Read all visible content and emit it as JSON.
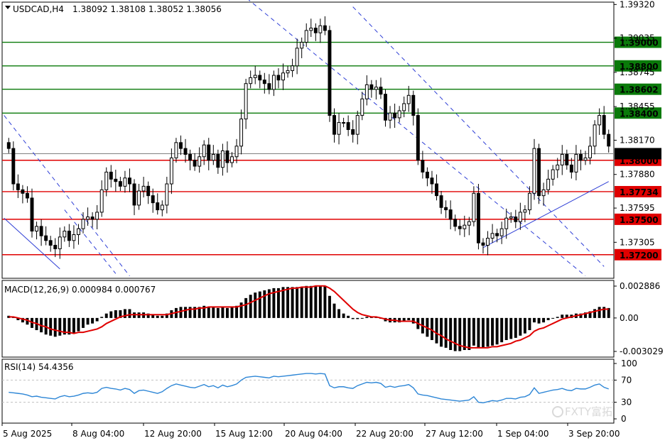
{
  "header": {
    "symbol_tf": "USDCAD,H4",
    "ohlc": "1.38092 1.38108 1.38052 1.38056"
  },
  "watermark": "FXTY富拓",
  "colors": {
    "bull": "#ffffff",
    "bear": "#000000",
    "candle_stroke": "#000000",
    "green_level": "#0a7a0a",
    "red_level": "#e00000",
    "channel": "#2f3fd6",
    "macd_signal": "#e00000",
    "rsi": "#2d86d6"
  },
  "main_chart": {
    "ylim": [
      1.37,
      1.3934
    ],
    "right_axis_ticks": [
      "1.39320",
      "1.39035",
      "1.38745",
      "1.38455",
      "1.38170",
      "1.37880",
      "1.37595",
      "1.37305"
    ],
    "current_price_label": "1.38056",
    "levels": [
      {
        "price": 1.39,
        "label": "1.39000",
        "color": "green"
      },
      {
        "price": 1.388,
        "label": "1.38800",
        "color": "green"
      },
      {
        "price": 1.38602,
        "label": "1.38602",
        "color": "green"
      },
      {
        "price": 1.384,
        "label": "1.38400",
        "color": "green"
      },
      {
        "price": 1.38,
        "label": "1.38000",
        "color": "red"
      },
      {
        "price": 1.37734,
        "label": "1.37734",
        "color": "red"
      },
      {
        "price": 1.375,
        "label": "1.37500",
        "color": "red"
      },
      {
        "price": 1.372,
        "label": "1.37200",
        "color": "red"
      }
    ]
  },
  "chart_data": {
    "type": "candlestick",
    "title": "USDCAD,H4",
    "x_tick_labels": [
      "5 Aug 2025",
      "8 Aug 04:00",
      "12 Aug 20:00",
      "15 Aug 12:00",
      "20 Aug 04:00",
      "22 Aug 20:00",
      "27 Aug 12:00",
      "1 Sep 04:00",
      "3 Sep 20:00"
    ],
    "close": [
      1.381,
      1.378,
      1.3775,
      1.3772,
      1.3768,
      1.374,
      1.3744,
      1.3736,
      1.3732,
      1.3728,
      1.3725,
      1.3735,
      1.374,
      1.3732,
      1.3737,
      1.3742,
      1.375,
      1.3752,
      1.375,
      1.3756,
      1.3775,
      1.379,
      1.3784,
      1.3782,
      1.3778,
      1.3785,
      1.378,
      1.3762,
      1.3774,
      1.3778,
      1.377,
      1.3764,
      1.3758,
      1.3762,
      1.378,
      1.3802,
      1.3815,
      1.381,
      1.3805,
      1.38,
      1.3795,
      1.3803,
      1.3813,
      1.38,
      1.3805,
      1.3794,
      1.3808,
      1.3798,
      1.3803,
      1.3812,
      1.3835,
      1.3865,
      1.387,
      1.3872,
      1.3868,
      1.3865,
      1.386,
      1.3872,
      1.3868,
      1.3874,
      1.3876,
      1.388,
      1.3895,
      1.39,
      1.391,
      1.3912,
      1.3908,
      1.3914,
      1.391,
      1.3838,
      1.3822,
      1.3832,
      1.3832,
      1.3826,
      1.3822,
      1.3838,
      1.3852,
      1.3864,
      1.386,
      1.3862,
      1.3856,
      1.3834,
      1.384,
      1.3836,
      1.3842,
      1.3848,
      1.3855,
      1.3838,
      1.38,
      1.379,
      1.3785,
      1.378,
      1.377,
      1.376,
      1.3758,
      1.375,
      1.3744,
      1.3742,
      1.3745,
      1.3748,
      1.3772,
      1.373,
      1.3728,
      1.3734,
      1.3738,
      1.3736,
      1.3742,
      1.3751,
      1.3752,
      1.3748,
      1.3756,
      1.3758,
      1.3772,
      1.381,
      1.377,
      1.3775,
      1.3784,
      1.3792,
      1.3796,
      1.3805,
      1.3796,
      1.379,
      1.3805,
      1.38,
      1.3802,
      1.3812,
      1.383,
      1.3838,
      1.3822,
      1.3812
    ],
    "series": [
      {
        "name": "MACD(12,26,9)",
        "last_main": 0.000984,
        "last_signal": 0.000767
      },
      {
        "name": "RSI(14)",
        "last": 54.4356
      }
    ],
    "macd_axis_labels": [
      "0.002886",
      "0.00",
      "-0.003029"
    ],
    "rsi_axis_labels": [
      "100",
      "70",
      "30",
      "0"
    ],
    "rsi_values": [
      48,
      47,
      46,
      45,
      43,
      40,
      41,
      39,
      38,
      37,
      36,
      40,
      42,
      40,
      41,
      43,
      46,
      47,
      46,
      48,
      55,
      57,
      55,
      54,
      52,
      55,
      53,
      46,
      51,
      52,
      50,
      48,
      46,
      49,
      55,
      60,
      63,
      61,
      59,
      57,
      56,
      59,
      62,
      58,
      60,
      56,
      61,
      58,
      60,
      63,
      70,
      75,
      76,
      77,
      76,
      75,
      74,
      77,
      76,
      77,
      78,
      79,
      80,
      81,
      82,
      82,
      81,
      82,
      81,
      60,
      56,
      58,
      58,
      56,
      55,
      60,
      63,
      66,
      65,
      66,
      64,
      57,
      59,
      57,
      59,
      60,
      62,
      56,
      45,
      43,
      42,
      40,
      38,
      36,
      35,
      34,
      33,
      32,
      33,
      34,
      40,
      30,
      29,
      31,
      33,
      32,
      34,
      37,
      37,
      36,
      39,
      40,
      44,
      56,
      46,
      48,
      50,
      52,
      53,
      55,
      52,
      51,
      55,
      54,
      54,
      57,
      61,
      63,
      57,
      54
    ],
    "ylim": [
      1.37,
      1.3934
    ]
  },
  "macd_panel": {
    "title": "MACD(12,26,9) 0.000984 0.000767",
    "histogram": [
      0.0002,
      0.0001,
      -0.0002,
      -0.0004,
      -0.0006,
      -0.0009,
      -0.0011,
      -0.0013,
      -0.0015,
      -0.0016,
      -0.0017,
      -0.0016,
      -0.0015,
      -0.0015,
      -0.0014,
      -0.0012,
      -0.0009,
      -0.0006,
      -0.0005,
      -0.0003,
      0.0001,
      0.0004,
      0.0006,
      0.0007,
      0.0007,
      0.0008,
      0.0008,
      0.0005,
      0.0005,
      0.0005,
      0.0004,
      0.0003,
      0.0002,
      0.0002,
      0.0004,
      0.0007,
      0.0009,
      0.001,
      0.001,
      0.001,
      0.001,
      0.001,
      0.0011,
      0.001,
      0.001,
      0.0009,
      0.001,
      0.0009,
      0.001,
      0.0011,
      0.0014,
      0.0018,
      0.0021,
      0.0023,
      0.0024,
      0.0025,
      0.0026,
      0.0027,
      0.0027,
      0.0028,
      0.0028,
      0.0028,
      0.0028,
      0.0028,
      0.0029,
      0.0029,
      0.0029,
      0.0029,
      0.0029,
      0.002,
      0.0013,
      0.0008,
      0.0004,
      0.0002,
      -0.0001,
      -0.0001,
      0.0,
      0.0001,
      0.0001,
      0.0001,
      0.0,
      -0.0003,
      -0.0004,
      -0.0004,
      -0.0004,
      -0.0003,
      -0.0002,
      -0.0005,
      -0.001,
      -0.0014,
      -0.0017,
      -0.002,
      -0.0023,
      -0.0026,
      -0.0027,
      -0.0029,
      -0.003,
      -0.003,
      -0.0029,
      -0.0029,
      -0.0025,
      -0.0027,
      -0.0027,
      -0.0026,
      -0.0025,
      -0.0024,
      -0.0022,
      -0.002,
      -0.0019,
      -0.0018,
      -0.0016,
      -0.0014,
      -0.0011,
      -0.0004,
      -0.0005,
      -0.0004,
      -0.0002,
      0.0,
      0.0001,
      0.0003,
      0.0003,
      0.0003,
      0.0004,
      0.0004,
      0.0005,
      0.0006,
      0.0008,
      0.001,
      0.001,
      0.0009
    ],
    "signal": [
      0.0001,
      0.0001,
      0.0,
      -0.0001,
      -0.0002,
      -0.0004,
      -0.0005,
      -0.0007,
      -0.0008,
      -0.001,
      -0.0011,
      -0.0012,
      -0.0013,
      -0.0013,
      -0.0014,
      -0.0013,
      -0.0013,
      -0.0012,
      -0.0011,
      -0.001,
      -0.0008,
      -0.0005,
      -0.0003,
      -0.0001,
      0.0001,
      0.0002,
      0.0003,
      0.0003,
      0.0003,
      0.0003,
      0.0003,
      0.0003,
      0.0003,
      0.0003,
      0.0003,
      0.0004,
      0.0005,
      0.0006,
      0.0007,
      0.0008,
      0.0008,
      0.0009,
      0.0009,
      0.001,
      0.001,
      0.001,
      0.001,
      0.001,
      0.001,
      0.001,
      0.0011,
      0.0012,
      0.0014,
      0.0016,
      0.0018,
      0.002,
      0.0022,
      0.0023,
      0.0024,
      0.0025,
      0.0026,
      0.0027,
      0.0027,
      0.0028,
      0.0028,
      0.0028,
      0.0029,
      0.0029,
      0.0029,
      0.0027,
      0.0024,
      0.002,
      0.0016,
      0.0012,
      0.0008,
      0.0005,
      0.0003,
      0.0002,
      0.0001,
      0.0001,
      0.0,
      -0.0001,
      -0.0002,
      -0.0002,
      -0.0003,
      -0.0003,
      -0.0003,
      -0.0003,
      -0.0005,
      -0.0007,
      -0.0009,
      -0.0011,
      -0.0014,
      -0.0016,
      -0.0019,
      -0.0021,
      -0.0023,
      -0.0025,
      -0.0026,
      -0.0027,
      -0.0027,
      -0.0027,
      -0.0027,
      -0.0027,
      -0.0026,
      -0.0026,
      -0.0025,
      -0.0024,
      -0.0023,
      -0.0021,
      -0.002,
      -0.0018,
      -0.0016,
      -0.0012,
      -0.001,
      -0.0009,
      -0.0007,
      -0.0005,
      -0.0003,
      -0.0001,
      0.0,
      0.0001,
      0.0002,
      0.0003,
      0.0004,
      0.0005,
      0.0006,
      0.0007,
      0.0008,
      0.0008
    ],
    "ylim": [
      -0.003029,
      0.002886
    ]
  },
  "rsi_panel": {
    "title": "RSI(14) 54.4356",
    "levels": [
      70,
      30
    ],
    "ylim": [
      0,
      100
    ]
  }
}
